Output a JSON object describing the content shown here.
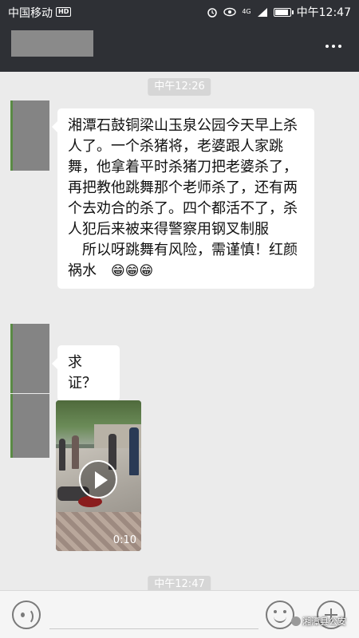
{
  "status_bar": {
    "carrier": "中国移动",
    "hd_badge": "HD",
    "network": "4G",
    "time": "中午12:47"
  },
  "nav_bar": {
    "title": "",
    "more_icon": "more-icon"
  },
  "chat": {
    "timestamps": [
      "中午12:26",
      "中午12:47"
    ],
    "messages": [
      {
        "type": "text",
        "paragraph_1": "湘潭石鼓铜梁山玉泉公园今天早上杀人了。一个杀猪将，老婆跟人家跳舞，他拿着平时杀猪刀把老婆杀了，再把教他跳舞那个老师杀了，还有两个去劝合的杀了。四个都活不了，杀人犯后来被来得警察用钢叉制服",
        "paragraph_2": "所以呀跳舞有风险，需谨慎！红颜祸水",
        "emojis": "😁😁😁"
      },
      {
        "type": "text",
        "text": "求证？"
      },
      {
        "type": "video",
        "duration": "0:10"
      }
    ]
  },
  "input_bar": {
    "voice_icon": "voice-icon",
    "emoji_icon": "emoji-icon",
    "plus_icon": "plus-icon"
  },
  "watermark": "湘潭县公安",
  "colors": {
    "header_bg": "#2e3035",
    "chat_bg": "#ebebeb",
    "bubble_bg": "#ffffff"
  }
}
